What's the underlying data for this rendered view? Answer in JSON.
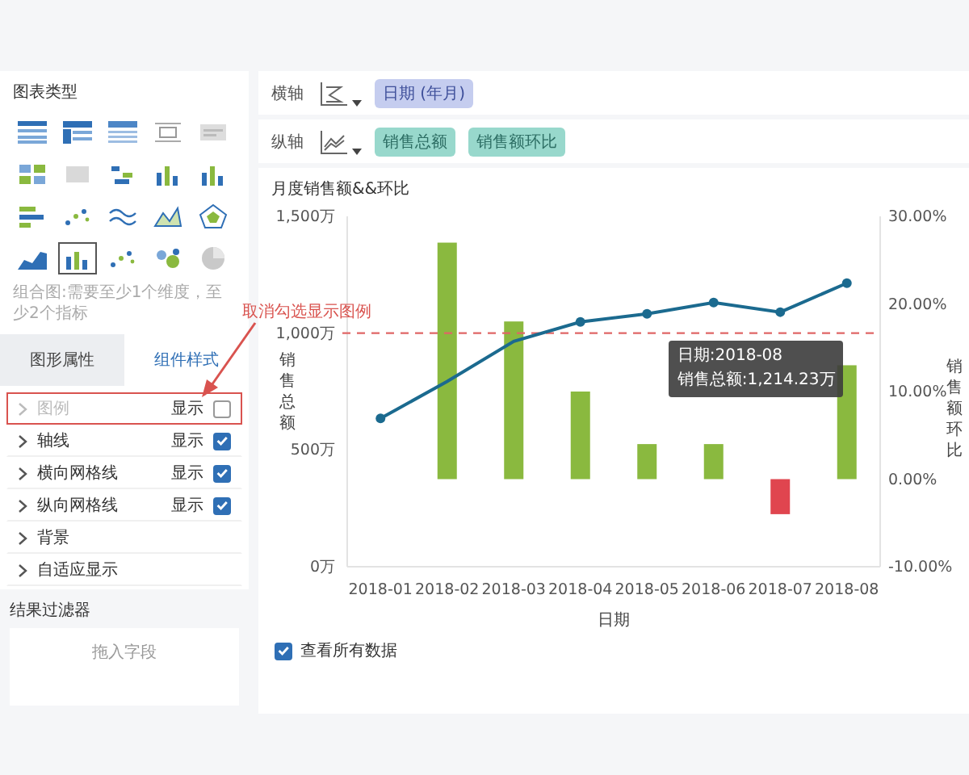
{
  "sidebar": {
    "chart_type_title": "图表类型",
    "chart_types": [
      {
        "kind": "table",
        "selected": false
      },
      {
        "kind": "cross-table",
        "selected": false
      },
      {
        "kind": "detail-table",
        "selected": false
      },
      {
        "kind": "number",
        "selected": false
      },
      {
        "kind": "text",
        "selected": false
      },
      {
        "kind": "card",
        "selected": false
      },
      {
        "kind": "blank",
        "selected": false
      },
      {
        "kind": "dot-bar",
        "selected": false
      },
      {
        "kind": "bar",
        "selected": false
      },
      {
        "kind": "bar",
        "selected": false
      },
      {
        "kind": "hbar",
        "selected": false
      },
      {
        "kind": "scatter",
        "selected": false
      },
      {
        "kind": "line",
        "selected": false
      },
      {
        "kind": "area-line",
        "selected": false
      },
      {
        "kind": "radar",
        "selected": false
      },
      {
        "kind": "area",
        "selected": false
      },
      {
        "kind": "combo",
        "selected": true
      },
      {
        "kind": "scatter",
        "selected": false
      },
      {
        "kind": "bubble",
        "selected": false
      },
      {
        "kind": "pie",
        "selected": false
      }
    ],
    "hint": "组合图:需要至少1个维度，至少2个指标",
    "tabs": [
      {
        "label": "图形属性",
        "selected": false
      },
      {
        "label": "组件样式",
        "selected": true
      }
    ],
    "properties": [
      {
        "label": "图例",
        "show_label": "显示",
        "checked": false,
        "disabled": true,
        "highlighted": true
      },
      {
        "label": "轴线",
        "show_label": "显示",
        "checked": true,
        "disabled": false,
        "highlighted": false
      },
      {
        "label": "横向网格线",
        "show_label": "显示",
        "checked": true,
        "disabled": false,
        "highlighted": false
      },
      {
        "label": "纵向网格线",
        "show_label": "显示",
        "checked": true,
        "disabled": false,
        "highlighted": false
      },
      {
        "label": "背景",
        "disabled": false,
        "highlighted": false
      },
      {
        "label": "自适应显示",
        "disabled": false,
        "highlighted": false
      }
    ],
    "filter_title": "结果过滤器",
    "filter_placeholder": "拖入字段"
  },
  "annotation": {
    "text": "取消勾选显示图例"
  },
  "axes": [
    {
      "label": "横轴",
      "kind": "dimension",
      "fields": [
        "日期 (年月)"
      ]
    },
    {
      "label": "纵轴",
      "kind": "measure",
      "fields": [
        "销售总额",
        "销售额环比"
      ]
    }
  ],
  "chart": {
    "title": "月度销售额&&环比",
    "chart_data": {
      "type": "bar",
      "xlabel": "日期",
      "ylabel": "销售总额",
      "y2label": "销售额环比",
      "categories": [
        "2018-01",
        "2018-02",
        "2018-03",
        "2018-04",
        "2018-05",
        "2018-06",
        "2018-07",
        "2018-08"
      ],
      "series": [
        {
          "type": "bar",
          "axis": "y2",
          "color": "#8ab93f",
          "values": [
            null,
            27,
            18,
            10,
            4,
            4,
            null,
            13
          ]
        },
        {
          "type": "bar",
          "axis": "y2",
          "color": "#e0454f",
          "values": [
            null,
            null,
            null,
            null,
            null,
            null,
            -4,
            null
          ]
        },
        {
          "type": "line",
          "color": "#1b6a8f",
          "values": [
            635,
            793,
            965,
            1048,
            1083,
            1131,
            1090,
            1214
          ]
        }
      ],
      "ylim": [
        0,
        1500
      ],
      "yticks": [
        {
          "value": 0,
          "label": "0万"
        },
        {
          "value": 500,
          "label": "500万"
        },
        {
          "value": 1000,
          "label": "1,000万"
        },
        {
          "value": 1500,
          "label": "1,500万"
        }
      ],
      "y2lim": [
        -10,
        30
      ],
      "y2ticks": [
        {
          "value": -10,
          "label": "-10.00%"
        },
        {
          "value": 0,
          "label": "0.00%"
        },
        {
          "value": 10,
          "label": "10.00%"
        },
        {
          "value": 20,
          "label": "20.00%"
        },
        {
          "value": 30,
          "label": "30.00%"
        }
      ],
      "ref_lines": [
        {
          "axis": "y",
          "value": 1000,
          "color": "#e06666"
        }
      ]
    },
    "tooltip": {
      "lines": [
        "日期:2018-08",
        "销售总额:1,214.23万"
      ]
    }
  },
  "show_all": {
    "label": "查看所有数据",
    "checked": true
  }
}
